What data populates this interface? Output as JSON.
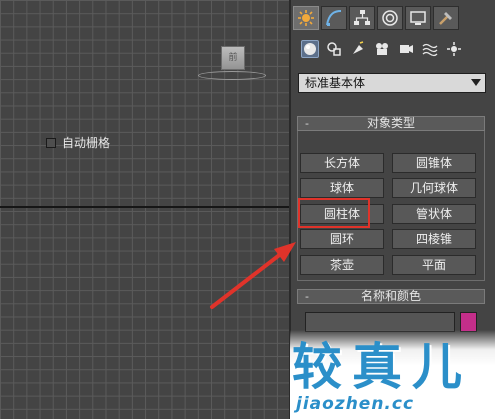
{
  "viewport": {
    "viewcube_label": "前"
  },
  "command_panel": {
    "tabs": [
      {
        "icon": "create-icon",
        "active": true
      },
      {
        "icon": "modify-icon",
        "active": false
      },
      {
        "icon": "hierarchy-icon",
        "active": false
      },
      {
        "icon": "motion-icon",
        "active": false
      },
      {
        "icon": "display-icon",
        "active": false
      },
      {
        "icon": "utilities-icon",
        "active": false
      }
    ],
    "subcategories": [
      {
        "icon": "geometry-icon",
        "active": true
      },
      {
        "icon": "shapes-icon",
        "active": false
      },
      {
        "icon": "lights-icon",
        "active": false
      },
      {
        "icon": "cameras-icon",
        "active": false
      },
      {
        "icon": "helpers-icon",
        "active": false
      },
      {
        "icon": "spacewarps-icon",
        "active": false
      },
      {
        "icon": "systems-icon",
        "active": false
      }
    ],
    "category_dropdown": "标准基本体",
    "object_type": {
      "title": "对象类型",
      "collapse_symbol": "-",
      "autogrid_label": "自动栅格",
      "autogrid_checked": false,
      "buttons": [
        "长方体",
        "圆锥体",
        "球体",
        "几何球体",
        "圆柱体",
        "管状体",
        "圆环",
        "四棱锥",
        "茶壶",
        "平面"
      ],
      "highlighted": "圆柱体"
    },
    "name_color": {
      "title": "名称和颜色",
      "collapse_symbol": "-",
      "name_value": "",
      "color": "#c42e8a"
    }
  },
  "annotation": {
    "arrow_color": "#e0332a"
  },
  "watermark": {
    "text_cn": "较真儿",
    "url": "jiaozhen.cc"
  }
}
